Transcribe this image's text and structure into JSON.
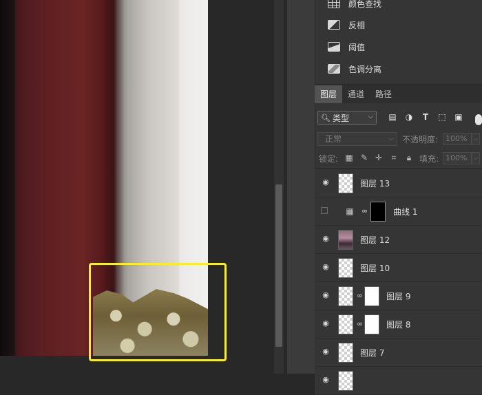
{
  "adjustments": {
    "items": [
      {
        "label": "颜色查找",
        "icon": "color-lookup-icon"
      },
      {
        "label": "反相",
        "icon": "invert-icon"
      },
      {
        "label": "阈值",
        "icon": "threshold-icon"
      },
      {
        "label": "色调分离",
        "icon": "posterize-icon"
      }
    ]
  },
  "layers_panel": {
    "tabs": [
      "图层",
      "通道",
      "路径"
    ],
    "active_tab": "图层",
    "filter": {
      "kind_label": "类型"
    },
    "blend_mode": "正常",
    "opacity_label": "不透明度:",
    "opacity_value": "100%",
    "lock_label": "锁定:",
    "fill_label": "填充:",
    "fill_value": "100%",
    "layers": [
      {
        "name": "图层 13",
        "visible": true,
        "type": "pixel"
      },
      {
        "name": "曲线 1",
        "visible": false,
        "type": "curves"
      },
      {
        "name": "图层 12",
        "visible": true,
        "type": "photo"
      },
      {
        "name": "图层 10",
        "visible": true,
        "type": "pixel"
      },
      {
        "name": "图层 9",
        "visible": true,
        "type": "masked"
      },
      {
        "name": "图层 8",
        "visible": true,
        "type": "masked"
      },
      {
        "name": "图层 7",
        "visible": true,
        "type": "pixel"
      }
    ]
  },
  "colors": {
    "highlight": "#f6ee2a",
    "panel": "#353535",
    "active_tab": "#535353"
  }
}
